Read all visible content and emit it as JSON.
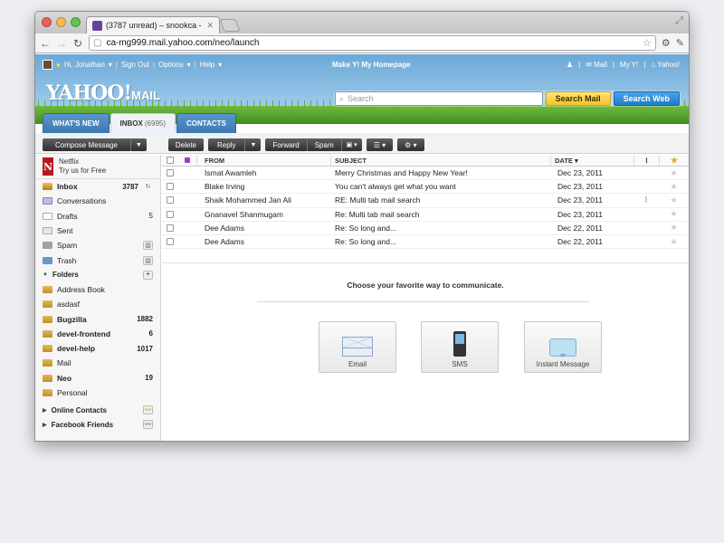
{
  "browser": {
    "tab_title": "(3787 unread) – snookca - Y",
    "url": "ca-mg999.mail.yahoo.com/neo/launch"
  },
  "header": {
    "greeting": "Hi, Jonathan",
    "links": [
      "Sign Out",
      "Options",
      "Help"
    ],
    "make_home": "Make Y! My Homepage",
    "right_links": [
      "Mail",
      "My Y!",
      "Yahoo!"
    ],
    "logo": "YAHOO!",
    "logo_suffix": "MAIL",
    "search_placeholder": "Search",
    "search_mail": "Search Mail",
    "search_web": "Search Web"
  },
  "tabs": [
    {
      "label": "WHAT'S NEW"
    },
    {
      "label": "INBOX",
      "count": "(6995)"
    },
    {
      "label": "CONTACTS"
    }
  ],
  "actions": {
    "compose": "Compose Message",
    "delete": "Delete",
    "reply": "Reply",
    "forward": "Forward",
    "spam": "Spam"
  },
  "promo": {
    "line1": "Netflix",
    "line2": "Try us for Free",
    "logo": "N"
  },
  "sidebar": {
    "system": [
      {
        "name": "Inbox",
        "count": "3787",
        "icon": "inbox",
        "bold": true
      },
      {
        "name": "Conversations",
        "count": "",
        "icon": "conv"
      },
      {
        "name": "Drafts",
        "count": "5",
        "icon": "draft"
      },
      {
        "name": "Sent",
        "count": "",
        "icon": "sent"
      },
      {
        "name": "Spam",
        "count": "",
        "icon": "spam"
      },
      {
        "name": "Trash",
        "count": "",
        "icon": "trash"
      }
    ],
    "folders_label": "Folders",
    "folders": [
      {
        "name": "Address Book",
        "count": ""
      },
      {
        "name": "asdasf",
        "count": ""
      },
      {
        "name": "Bugzilla",
        "count": "1882",
        "bold": true
      },
      {
        "name": "devel-frontend",
        "count": "6",
        "bold": true
      },
      {
        "name": "devel-help",
        "count": "1017",
        "bold": true
      },
      {
        "name": "Mail",
        "count": ""
      },
      {
        "name": "Neo",
        "count": "19",
        "bold": true
      },
      {
        "name": "Personal",
        "count": ""
      }
    ],
    "online_contacts": "Online Contacts",
    "facebook_friends": "Facebook Friends"
  },
  "columns": {
    "from": "FROM",
    "subject": "SUBJECT",
    "date": "DATE"
  },
  "messages": [
    {
      "from": "Ismat Awamleh",
      "subject": "Merry Christmas and Happy New Year!",
      "date": "Dec 23, 2011",
      "attach": false
    },
    {
      "from": "Blake Irving",
      "subject": "You can't always get what you want",
      "date": "Dec 23, 2011",
      "attach": false
    },
    {
      "from": "Shaik Mohammed Jan Ali",
      "subject": "RE: Multi tab mail search",
      "date": "Dec 23, 2011",
      "attach": true
    },
    {
      "from": "Gnanavel Shanmugam",
      "subject": "Re: Multi tab mail search",
      "date": "Dec 23, 2011",
      "attach": false
    },
    {
      "from": "Dee Adams",
      "subject": "Re: So long and...",
      "date": "Dec 22, 2011",
      "attach": false
    },
    {
      "from": "Dee Adams",
      "subject": "Re: So long and...",
      "date": "Dec 22, 2011",
      "attach": false
    }
  ],
  "communicate": {
    "title": "Choose your favorite way to communicate.",
    "options": [
      "Email",
      "SMS",
      "Instant Message"
    ]
  }
}
